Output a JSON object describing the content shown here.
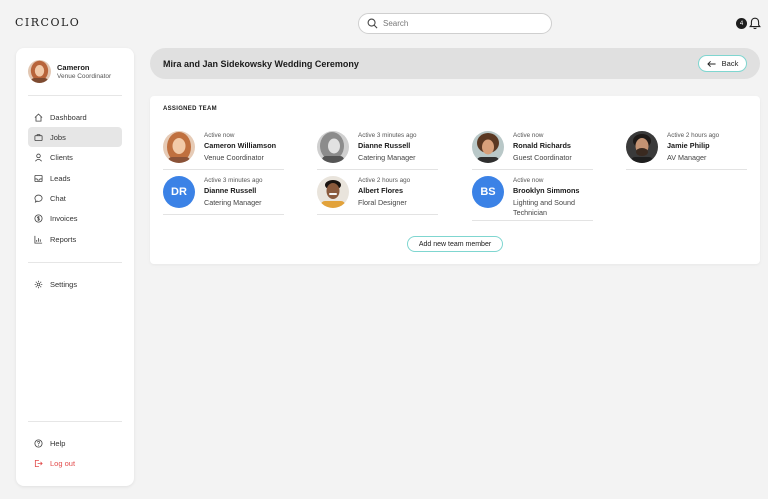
{
  "app": {
    "logo": "CIRCOLO"
  },
  "search": {
    "placeholder": "Search"
  },
  "notifications": {
    "badge": "4"
  },
  "user": {
    "name": "Cameron",
    "role": "Venue Coordinator"
  },
  "nav": {
    "items": [
      {
        "label": "Dashboard",
        "icon": "home-icon",
        "active": false
      },
      {
        "label": "Jobs",
        "icon": "briefcase-icon",
        "active": true
      },
      {
        "label": "Clients",
        "icon": "user-icon",
        "active": false
      },
      {
        "label": "Leads",
        "icon": "inbox-icon",
        "active": false
      },
      {
        "label": "Chat",
        "icon": "chat-icon",
        "active": false
      },
      {
        "label": "Invoices",
        "icon": "dollar-icon",
        "active": false
      },
      {
        "label": "Reports",
        "icon": "chart-icon",
        "active": false
      }
    ],
    "settings": "Settings",
    "help": "Help",
    "logout": "Log out"
  },
  "page": {
    "title": "Mira and Jan Sidekowsky Wedding Ceremony",
    "back_label": "Back"
  },
  "team": {
    "heading": "ASSIGNED TEAM",
    "members": [
      {
        "status": "Active now",
        "name": "Cameron Williamson",
        "role": "Venue Coordinator",
        "avatar": "photo"
      },
      {
        "status": "Active 3 minutes ago",
        "name": "Dianne Russell",
        "role": "Catering Manager",
        "avatar": "photo"
      },
      {
        "status": "Active now",
        "name": "Ronald Richards",
        "role": "Guest Coordinator",
        "avatar": "photo"
      },
      {
        "status": "Active 2 hours ago",
        "name": "Jamie Philip",
        "role": "AV Manager",
        "avatar": "photo"
      },
      {
        "status": "Active 3 minutes ago",
        "name": "Dianne Russell",
        "role": "Catering Manager",
        "initials": "DR"
      },
      {
        "status": "Active 2 hours ago",
        "name": "Albert Flores",
        "role": "Floral Designer",
        "avatar": "photo"
      },
      {
        "status": "Active now",
        "name": "Brooklyn Simmons",
        "role": "Lighting and Sound Technician",
        "initials": "BS"
      }
    ],
    "add_label": "Add new team member"
  },
  "colors": {
    "accent": "#7fd6d0",
    "initials_bg": "#3b82e6",
    "logout": "#e24b4b"
  }
}
